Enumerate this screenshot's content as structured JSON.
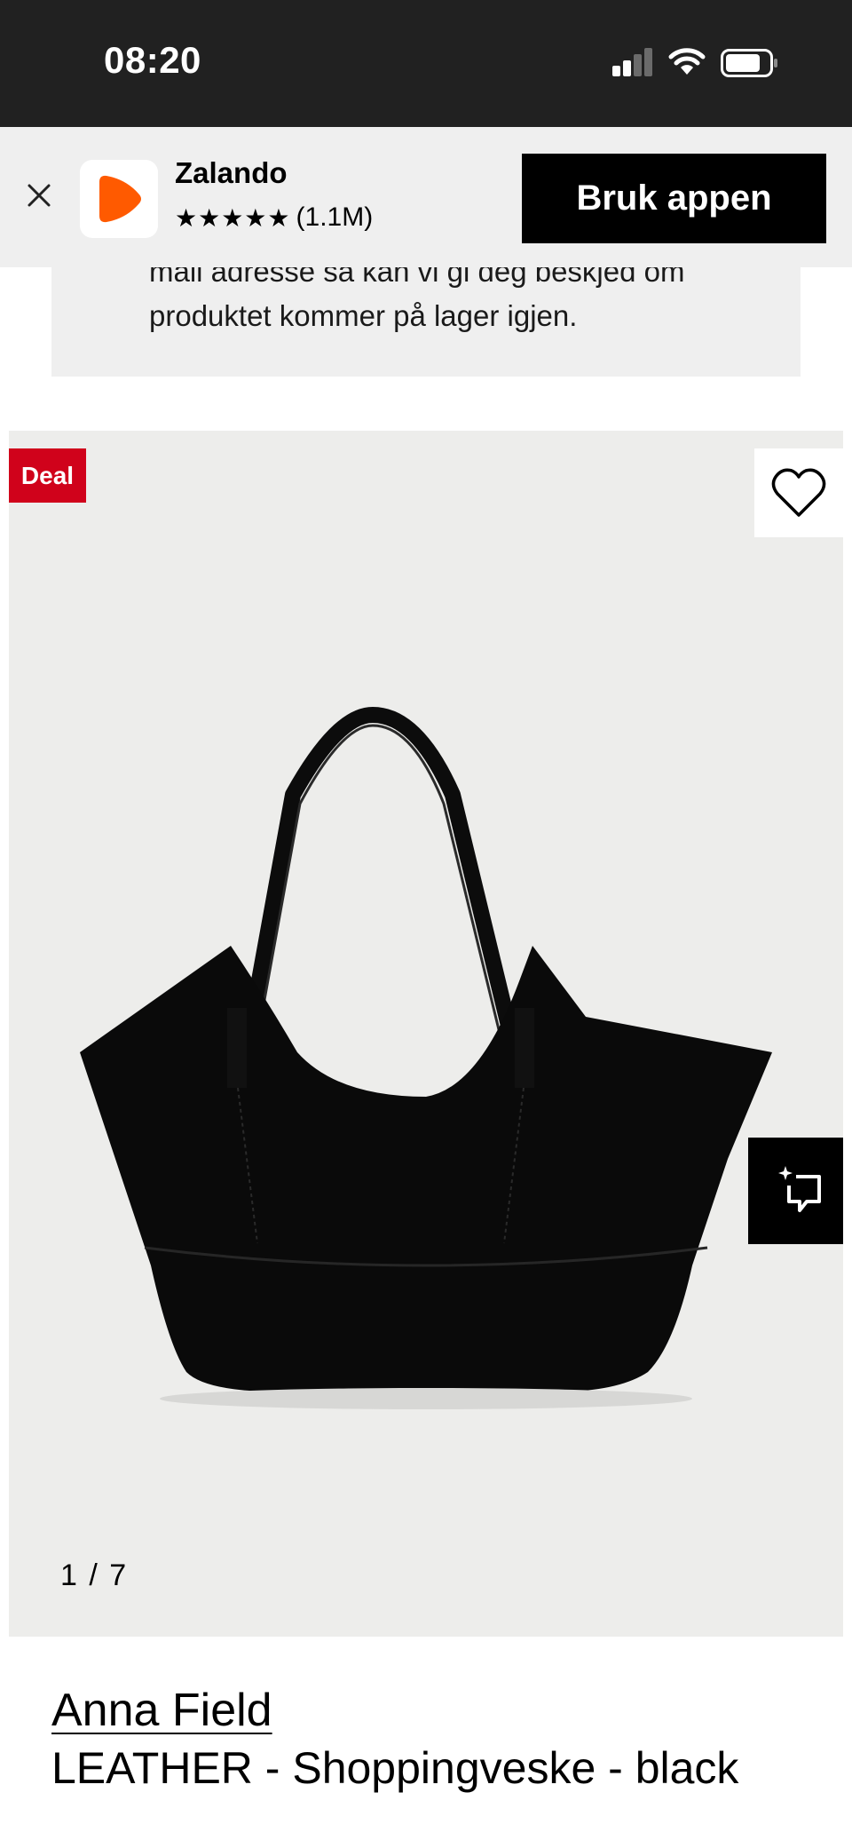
{
  "status_bar": {
    "time": "08:20"
  },
  "app_banner": {
    "app_name": "Zalando",
    "stars": "★★★★★",
    "rating_count": "(1.1M)",
    "cta_label": "Bruk appen",
    "brand_color": "#ff6900"
  },
  "notify": {
    "text": "mail adresse så kan vi gi deg beskjed om produktet kommer på lager igjen."
  },
  "gallery": {
    "deal_label": "Deal",
    "deal_color": "#d0021b",
    "counter": "1 / 7",
    "icons": [
      "heart-icon",
      "sparkle-frame-icon"
    ]
  },
  "product": {
    "brand": "Anna Field",
    "name": "LEATHER - Shoppingveske - black"
  }
}
